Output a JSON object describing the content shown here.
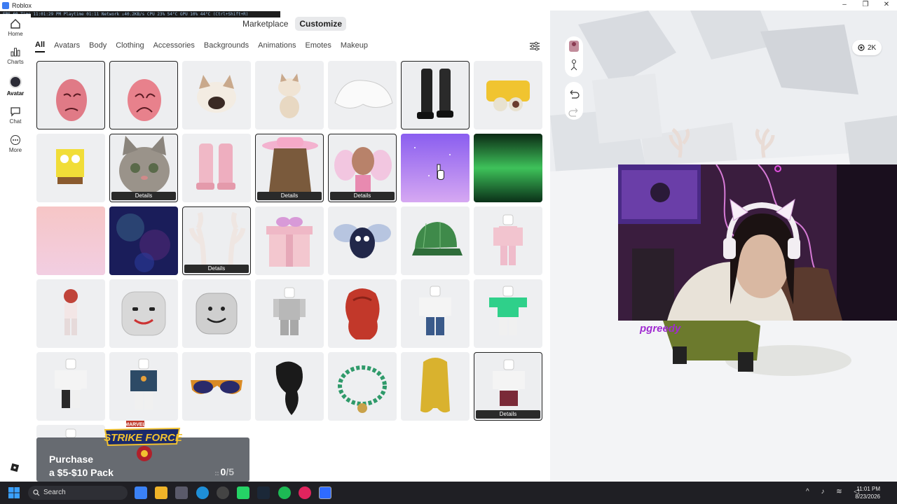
{
  "window": {
    "title": "Roblox",
    "controls": [
      "–",
      "❐",
      "✕"
    ]
  },
  "overlay_stats": "FPS 60  Time 11:01:29 PM  Playtime 01:11  Network ↓40.2KB/s  CPU 23%  54°C  GPU 10%  44°C  (Ctrl+Shift+R)",
  "nav": {
    "home": "Home",
    "charts": "Charts",
    "avatar": "Avatar",
    "chat": "Chat",
    "more": "More"
  },
  "top_tabs": {
    "marketplace": "Marketplace",
    "customize": "Customize"
  },
  "categories": [
    "All",
    "Avatars",
    "Body",
    "Clothing",
    "Accessories",
    "Backgrounds",
    "Animations",
    "Emotes",
    "Makeup"
  ],
  "grid": {
    "details_label": "Details",
    "items": [
      {
        "name": "patrick-head-1",
        "selected": true,
        "details": false
      },
      {
        "name": "patrick-head-2",
        "selected": true,
        "details": false
      },
      {
        "name": "french-bulldog-head",
        "selected": false,
        "details": false
      },
      {
        "name": "bulldog-pet",
        "selected": false,
        "details": false
      },
      {
        "name": "white-fur-shoulder",
        "selected": false,
        "details": false
      },
      {
        "name": "black-boots",
        "selected": true,
        "details": false
      },
      {
        "name": "yellow-hat-eye",
        "selected": false,
        "details": false
      },
      {
        "name": "spongebob",
        "selected": false,
        "details": false
      },
      {
        "name": "cat-head",
        "selected": true,
        "details": true
      },
      {
        "name": "pink-boots",
        "selected": false,
        "details": false
      },
      {
        "name": "pink-cowboy-hat-hair",
        "selected": true,
        "details": true
      },
      {
        "name": "fairy-character",
        "selected": true,
        "details": true
      },
      {
        "name": "purple-sparkle-background",
        "selected": false,
        "details": false
      },
      {
        "name": "green-aurora-background",
        "selected": false,
        "details": false
      },
      {
        "name": "pink-sky-background",
        "selected": false,
        "details": false
      },
      {
        "name": "dark-nebula-background",
        "selected": false,
        "details": false
      },
      {
        "name": "antlers",
        "selected": true,
        "details": true
      },
      {
        "name": "gift-box",
        "selected": false,
        "details": false
      },
      {
        "name": "bug-pet",
        "selected": false,
        "details": false
      },
      {
        "name": "green-plaid-cap",
        "selected": false,
        "details": false
      },
      {
        "name": "pink-body",
        "selected": false,
        "details": false
      },
      {
        "name": "red-hair-avatar",
        "selected": false,
        "details": false
      },
      {
        "name": "smile-face",
        "selected": false,
        "details": false
      },
      {
        "name": "classic-smile-head",
        "selected": false,
        "details": false
      },
      {
        "name": "gray-body",
        "selected": false,
        "details": false
      },
      {
        "name": "red-curly-hair",
        "selected": false,
        "details": false
      },
      {
        "name": "blue-jeans-outfit",
        "selected": false,
        "details": false
      },
      {
        "name": "green-shirt-outfit",
        "selected": false,
        "details": false
      },
      {
        "name": "black-pants-outfit",
        "selected": false,
        "details": false
      },
      {
        "name": "navy-shirt-outfit",
        "selected": false,
        "details": false
      },
      {
        "name": "orange-sunglasses",
        "selected": false,
        "details": false
      },
      {
        "name": "black-ponytail",
        "selected": false,
        "details": false
      },
      {
        "name": "bead-necklace",
        "selected": false,
        "details": false
      },
      {
        "name": "blonde-hair",
        "selected": false,
        "details": false
      },
      {
        "name": "maroon-pants-outfit",
        "selected": true,
        "details": true
      },
      {
        "name": "blue-outfit-partial",
        "selected": false,
        "details": false
      }
    ]
  },
  "promo": {
    "line1": "Purchase",
    "line2": "a $5-$10 Pack",
    "count": "0",
    "total": "/5",
    "logo_top": "MARVEL",
    "logo_main": "STRIKE FORCE"
  },
  "scene": {
    "robux": "2K"
  },
  "stream": {
    "name": "pgreedy"
  },
  "taskbar": {
    "search": "Search",
    "time": "11:01 PM",
    "date": "8/23/2026"
  },
  "colors": {
    "accent": "#a02bd1",
    "taskbar": "#1f1f24",
    "tile": "#eeeff1"
  }
}
